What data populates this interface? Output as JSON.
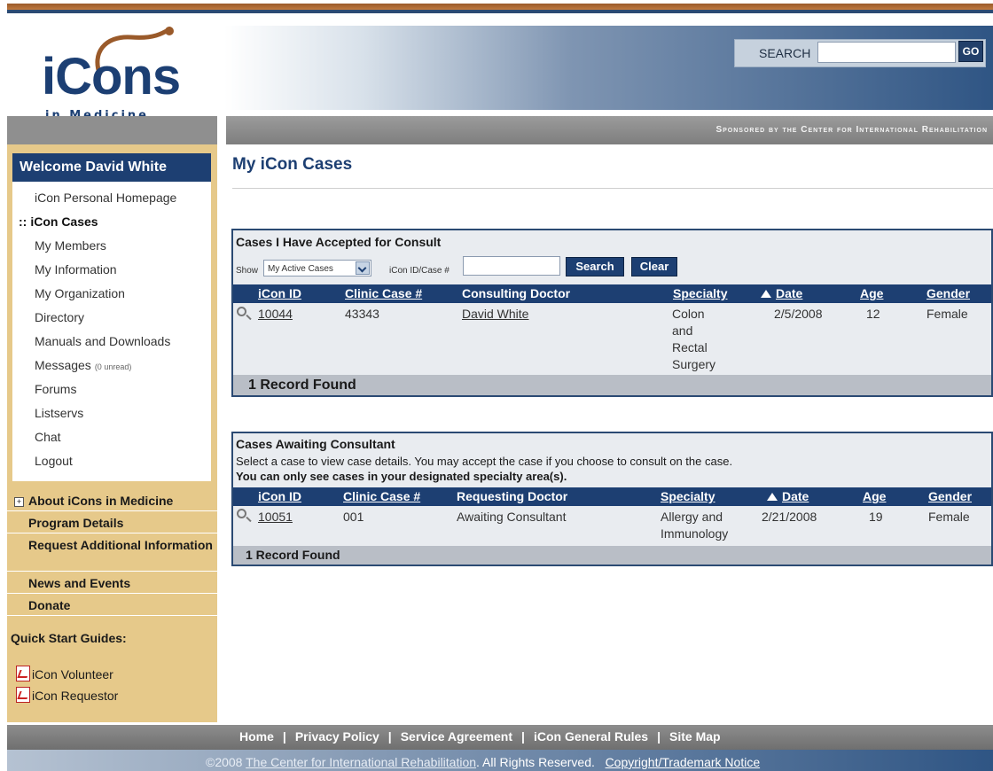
{
  "header": {
    "logo_text": "iCons",
    "logo_subtext": "in Medicine",
    "search_label": "SEARCH",
    "search_value": "",
    "search_button": "GO",
    "sponsor": "Sponsored by the Center for International Rehabilitation"
  },
  "sidebar": {
    "welcome": "Welcome David White",
    "menu": [
      {
        "label": "iCon Personal Homepage",
        "active": false
      },
      {
        "label": "iCon Cases",
        "active": true,
        "marker": "::"
      },
      {
        "label": "My Members",
        "active": false
      },
      {
        "label": "My Information",
        "active": false
      },
      {
        "label": "My Organization",
        "active": false
      },
      {
        "label": "Directory",
        "active": false
      },
      {
        "label": "Manuals and Downloads",
        "active": false
      },
      {
        "label": "Messages",
        "active": false,
        "extra": "(0 unread)"
      },
      {
        "label": "Forums",
        "active": false
      },
      {
        "label": "Listservs",
        "active": false
      },
      {
        "label": "Chat",
        "active": false
      },
      {
        "label": "Logout",
        "active": false
      }
    ],
    "nav": [
      {
        "label": "About iCons in Medicine",
        "expand": "+"
      },
      {
        "label": "Program Details"
      },
      {
        "label": "Request Additional Information"
      },
      {
        "label": "News and Events"
      },
      {
        "label": "Donate"
      }
    ],
    "quick_start_title": "Quick Start Guides:",
    "quick_start": [
      "iCon Volunteer",
      "iCon Requestor"
    ]
  },
  "main": {
    "title": "My iCon Cases",
    "accepted": {
      "heading": "Cases I Have Accepted for Consult",
      "show_label": "Show",
      "show_value": "My Active Cases",
      "id_label": "iCon ID/Case #",
      "id_value": "",
      "search_button": "Search",
      "clear_button": "Clear",
      "columns": [
        "iCon ID",
        "Clinic Case #",
        "Consulting Doctor",
        "Specialty",
        "Date",
        "Age",
        "Gender"
      ],
      "rows": [
        {
          "id": "10044",
          "clinic": "43343",
          "doctor": "David White",
          "specialty_lines": [
            "Colon",
            "and",
            "Rectal",
            "Surgery"
          ],
          "date": "2/5/2008",
          "age": "12",
          "gender": "Female"
        }
      ],
      "footer": "1 Record Found"
    },
    "awaiting": {
      "heading": "Cases Awaiting Consultant",
      "note1": "Select a case to view case details. You may accept the case if you choose to consult on the case.",
      "note2": "You can only see cases in your designated specialty area(s).",
      "columns": [
        "iCon ID",
        "Clinic Case #",
        "Requesting Doctor",
        "Specialty",
        "Date",
        "Age",
        "Gender"
      ],
      "rows": [
        {
          "id": "10051",
          "clinic": "001",
          "doctor": "Awaiting Consultant",
          "specialty_lines": [
            "Allergy and",
            "Immunology"
          ],
          "date": "2/21/2008",
          "age": "19",
          "gender": "Female"
        }
      ],
      "footer": "1 Record Found"
    }
  },
  "footer": {
    "links": [
      "Home",
      "Privacy Policy",
      "Service Agreement",
      "iCon General Rules",
      "Site Map"
    ],
    "separator": "|",
    "copyright_year": "©2008",
    "copyright_org": "The Center for International Rehabilitation",
    "copyright_rest": ". All Rights Reserved.",
    "notice": "Copyright/Trademark Notice"
  }
}
